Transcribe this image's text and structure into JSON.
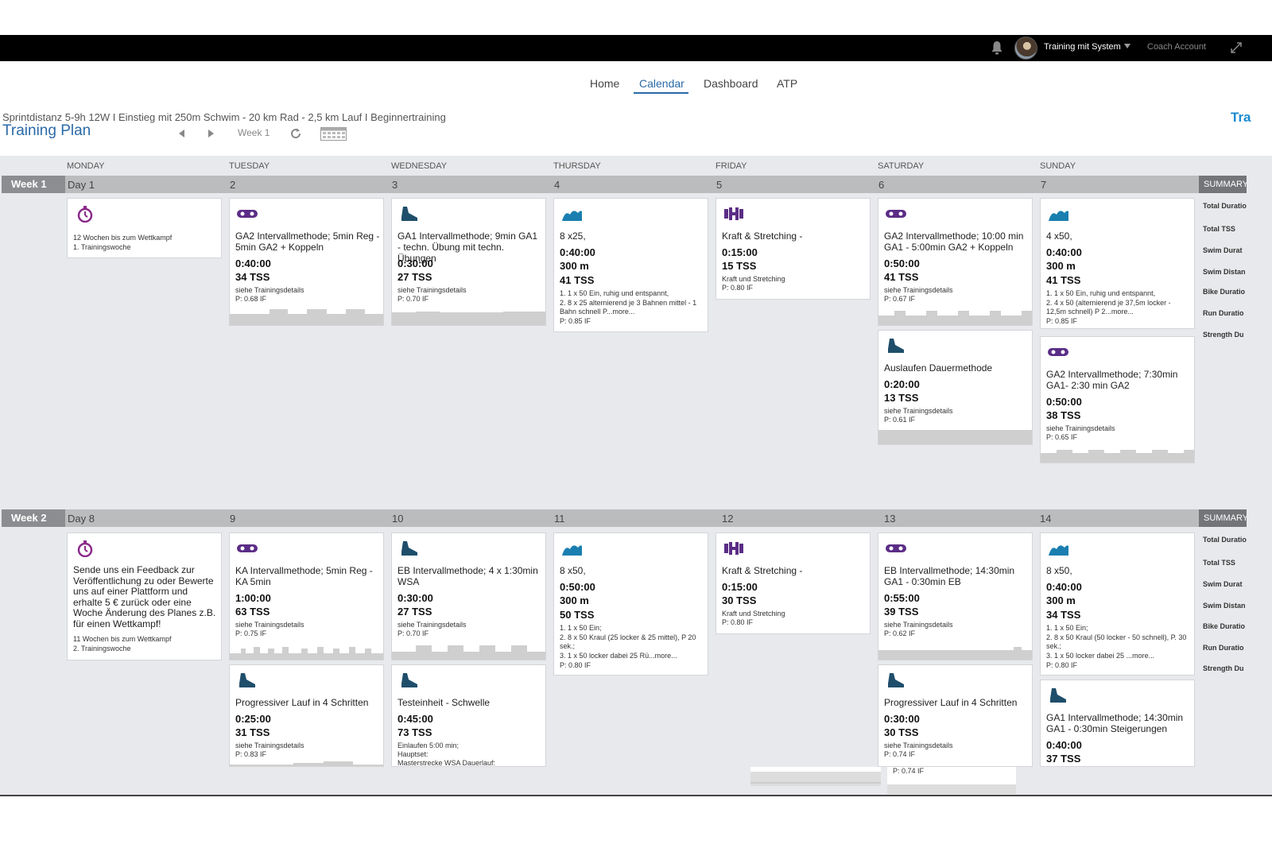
{
  "topbar": {
    "user_name": "Training mit System",
    "coach_label": "Coach Account"
  },
  "nav": {
    "items": [
      "Home",
      "Calendar",
      "Dashboard",
      "ATP"
    ],
    "active": "Calendar"
  },
  "plan": {
    "subtitle": "Sprintdistanz 5-9h 12W I Einstieg mit 250m Schwim - 20 km Rad - 2,5 km Lauf I Beginnertraining",
    "title": "Training Plan",
    "week_label": "Week 1",
    "brand_fragment": "Tra"
  },
  "days": [
    "MONDAY",
    "TUESDAY",
    "WEDNESDAY",
    "THURSDAY",
    "FRIDAY",
    "SATURDAY",
    "SUNDAY"
  ],
  "summary": {
    "header": "SUMMARY",
    "rows": [
      "Total Duratio",
      "Total TSS",
      "Swim Durat",
      "Swim Distan",
      "Bike Duratio",
      "Run Duratio",
      "Strength Du"
    ]
  },
  "weeks": [
    {
      "label": "Week 1",
      "day_numbers": [
        "Day 1",
        "2",
        "3",
        "4",
        "5",
        "6",
        "7"
      ],
      "cards": [
        {
          "type": "event",
          "title": "",
          "notes": [
            "12 Wochen bis zum Wettkampf",
            "1. Trainingswoche"
          ]
        },
        {
          "type": "bike",
          "title": "GA2 Intervallmethode; 5min Reg - 5min GA2 + Koppeln",
          "duration": "0:40:00",
          "tss": "34",
          "notes": [
            "siehe Trainingsdetails",
            "P: 0.68 IF"
          ]
        },
        {
          "type": "run",
          "title": "GA1 Intervallmethode; 9min GA1 - techn. Übung mit techn. Übungen",
          "duration": "0:30:00",
          "tss": "27",
          "notes": [
            "siehe Trainingsdetails",
            "P: 0.70 IF"
          ]
        },
        {
          "type": "swim",
          "title": "8 x25,",
          "duration": "0:40:00",
          "distance": "300 m",
          "tss": "41",
          "notes": [
            "1. 1 x 50 Ein, ruhig und entspannt,",
            "2. 8 x 25 alternierend je 3 Bahnen mittel - 1 Bahn schnell P...more...",
            "P: 0.85 IF"
          ]
        },
        {
          "type": "strength",
          "title": "Kraft & Stretching -",
          "duration": "0:15:00",
          "tss": "15",
          "notes": [
            "Kraft und Stretching",
            "P: 0.80 IF"
          ]
        },
        {
          "type": "bike",
          "title": "GA2 Intervallmethode; 10:00 min GA1 - 5:00min GA2 + Koppeln",
          "duration": "0:50:00",
          "tss": "41",
          "notes": [
            "siehe Trainingsdetails",
            "P: 0.67 IF"
          ]
        },
        {
          "type": "swim",
          "title": "4 x50,",
          "duration": "0:40:00",
          "distance": "300 m",
          "tss": "41",
          "notes": [
            "1. 1 x 50 Ein, ruhig und entspannt,",
            "2. 4 x 50 (alternierend je 37,5m locker - 12,5m schnell) P 2...more...",
            "P: 0.85 IF"
          ]
        },
        {
          "type": "run",
          "title": "Auslaufen Dauermethode",
          "duration": "0:20:00",
          "tss": "13",
          "notes": [
            "siehe Trainingsdetails",
            "P: 0.61 IF"
          ]
        },
        {
          "type": "bike",
          "title": "GA2 Intervallmethode; 7:30min GA1- 2:30 min GA2",
          "duration": "0:50:00",
          "tss": "38",
          "notes": [
            "siehe Trainingsdetails",
            "P: 0.65 IF"
          ]
        }
      ]
    },
    {
      "label": "Week 2",
      "day_numbers": [
        "Day 8",
        "9",
        "10",
        "11",
        "12",
        "13",
        "14"
      ],
      "cards": [
        {
          "type": "event",
          "title": "Sende uns ein Feedback zur Veröffentlichung zu oder Bewerte uns auf einer Plattform und erhalte 5 € zurück oder eine Woche Änderung des Planes z.B. für einen Wettkampf!",
          "notes": [
            "11 Wochen bis zum Wettkampf",
            "2. Trainingswoche"
          ]
        },
        {
          "type": "bike",
          "title": "KA Intervallmethode; 5min Reg - KA 5min",
          "duration": "1:00:00",
          "tss": "63",
          "notes": [
            "siehe Trainingsdetails",
            "P: 0.75 IF"
          ]
        },
        {
          "type": "run",
          "title": "EB Intervallmethode; 4 x 1:30min WSA",
          "duration": "0:30:00",
          "tss": "27",
          "notes": [
            "siehe Trainingsdetails",
            "P: 0.70 IF"
          ]
        },
        {
          "type": "swim",
          "title": "8 x50,",
          "duration": "0:50:00",
          "distance": "300 m",
          "tss": "50",
          "notes": [
            "1. 1 x 50 Ein;",
            "2. 8 x 50 Kraul (25 locker & 25 mittel), P 20 sek.;",
            "3. 1 x 50 locker dabei 25 Rü...more...",
            "P: 0.80 IF"
          ]
        },
        {
          "type": "strength",
          "title": "Kraft & Stretching -",
          "duration": "0:15:00",
          "tss": "30",
          "notes": [
            "Kraft und Stretching",
            "P: 0.80 IF"
          ]
        },
        {
          "type": "bike",
          "title": "EB Intervallmethode; 14:30min GA1 - 0:30min EB",
          "duration": "0:55:00",
          "tss": "39",
          "notes": [
            "siehe Trainingsdetails",
            "P: 0.62 IF"
          ]
        },
        {
          "type": "swim",
          "title": "8 x50,",
          "duration": "0:40:00",
          "distance": "300 m",
          "tss": "34",
          "notes": [
            "1. 1 x 50 Ein;",
            "2. 8 x 50 Kraul (50 locker - 50 schnell), P. 30 sek.;",
            "3. 1 x 50 locker dabei 25 ...more...",
            "P: 0.80 IF"
          ]
        },
        {
          "type": "run",
          "title": "Progressiver Lauf in 4 Schritten",
          "duration": "0:25:00",
          "tss": "31",
          "notes": [
            "siehe Trainingsdetails",
            "P: 0.83 IF"
          ]
        },
        {
          "type": "run",
          "title": "Testeinheit - Schwelle",
          "duration": "0:45:00",
          "tss": "73",
          "notes": [
            "Einlaufen 5:00 min;",
            "Hauptset:",
            "Masterstrecke WSA Dauerlauf:"
          ]
        },
        {
          "type": "run",
          "title": "Progressiver Lauf in 4 Schritten",
          "duration": "0:30:00",
          "tss": "30",
          "notes": [
            "siehe Trainingsdetails",
            "P: 0.74 IF"
          ]
        },
        {
          "type": "run",
          "title": "GA1 Intervallmethode; 14:30min GA1 - 0:30min Steigerungen",
          "duration": "0:40:00",
          "tss": "37",
          "notes": []
        }
      ]
    }
  ],
  "stray_note": "P: 0.74 IF",
  "tss_unit": "TSS",
  "colors": {
    "bike": "#5b2d86",
    "run": "#1f4e6b",
    "swim": "#1a7fb0",
    "strength": "#5b2d86",
    "event": "#8b2a8b",
    "accent": "#2a6aa8"
  },
  "icons": {
    "bike": "bike-icon",
    "run": "shoe-icon",
    "swim": "wave-icon",
    "strength": "dumbbell-icon",
    "event": "stopwatch-icon"
  }
}
